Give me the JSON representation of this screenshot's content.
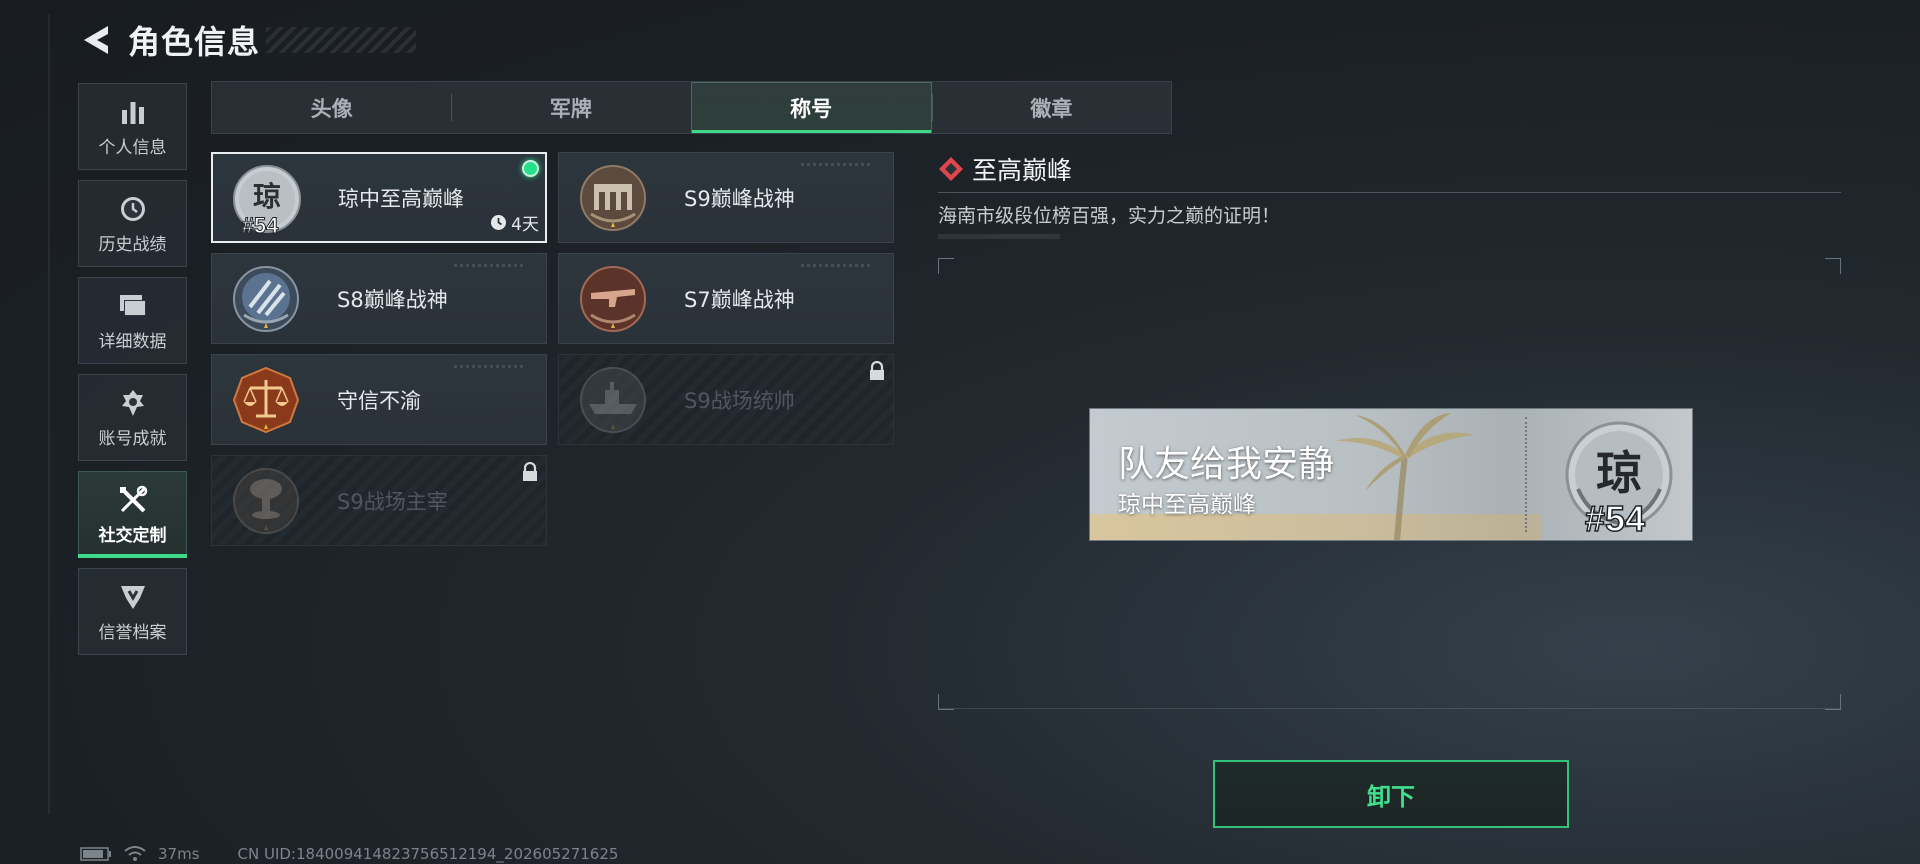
{
  "header": {
    "title": "角色信息"
  },
  "sidebar": {
    "items": [
      {
        "label": "个人信息",
        "icon": "bar-chart-icon"
      },
      {
        "label": "历史战绩",
        "icon": "history-clock-icon"
      },
      {
        "label": "详细数据",
        "icon": "folders-icon"
      },
      {
        "label": "账号成就",
        "icon": "achievement-icon"
      },
      {
        "label": "社交定制",
        "icon": "tools-icon",
        "active": true
      },
      {
        "label": "信誉档案",
        "icon": "credit-shield-icon"
      }
    ]
  },
  "tabs": [
    {
      "label": "头像"
    },
    {
      "label": "军牌"
    },
    {
      "label": "称号",
      "active": true
    },
    {
      "label": "徽章"
    }
  ],
  "titles": [
    {
      "name": "琼中至高巅峰",
      "emblem": "qiong-rank-emblem",
      "emblem_text": "琼",
      "emblem_rank": "#54",
      "selected": true,
      "equipped": true,
      "timer": "4天"
    },
    {
      "name": "S9巅峰战神",
      "emblem": "fortress-emblem"
    },
    {
      "name": "S8巅峰战神",
      "emblem": "striped-globe-emblem"
    },
    {
      "name": "S7巅峰战神",
      "emblem": "rifle-emblem"
    },
    {
      "name": "守信不渝",
      "emblem": "scales-emblem"
    },
    {
      "name": "S9战场统帅",
      "emblem": "warship-emblem",
      "locked": true
    },
    {
      "name": "S9战场主宰",
      "emblem": "mushroom-cloud-emblem",
      "locked": true
    }
  ],
  "detail": {
    "title": "至高巅峰",
    "description": "海南市级段位榜百强，实力之巅的证明！"
  },
  "preview": {
    "player_name": "队友给我安静",
    "title_name": "琼中至高巅峰",
    "badge_text": "琼",
    "badge_rank": "#54"
  },
  "actions": {
    "unequip_label": "卸下"
  },
  "status": {
    "ping": "37ms",
    "uid": "CN UID:18400941482375651​2194_202605271625"
  },
  "colors": {
    "accent": "#3fd98a",
    "equipped_dot": "#27e08a",
    "detail_icon": "#e0474c"
  }
}
